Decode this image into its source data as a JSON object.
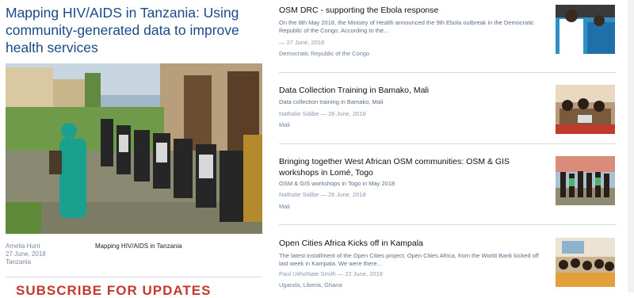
{
  "featured": {
    "title": "Mapping HIV/AIDS in Tanzania: Using community-generated data to improve health services",
    "author": "Amelia Hunt",
    "date": "27 June, 2018",
    "location": "Tanzania",
    "caption": "Mapping HIV/AIDS in Tanzania"
  },
  "subscribe": {
    "label": "SUBSCRIBE FOR UPDATES"
  },
  "news": [
    {
      "title": "OSM DRC - supporting the Ebola response",
      "excerpt": "On the 8th May 2018, the Ministry of Health announced the 9th Ebola outbreak in the Democratic Republic of the Congo. According to the...",
      "byline": "— 27 June, 2018",
      "place": "Democratic Republic of the Congo"
    },
    {
      "title": "Data Collection Training in Bamako, Mali",
      "excerpt": "Data collection training in Bamako, Mali",
      "byline": "Nathalie Sidibe — 26 June, 2018",
      "place": "Mali"
    },
    {
      "title": "Bringing together West African OSM communities: OSM & GIS workshops in Lomé, Togo",
      "excerpt": "OSM & GIS workshops in Togo in May 2018",
      "byline": "Nathalie Sidibe — 26 June, 2018",
      "place": "Mali"
    },
    {
      "title": "Open Cities Africa Kicks off in Kampala",
      "excerpt": "The latest installment of the Open Cities project, Open Cities Africa, from the World Bank kicked off last week in Kampala. We were there...",
      "byline": "Paul UithoNate Smith — 22 June, 2018",
      "place": "Uganda, Liberia, Ghana"
    }
  ]
}
